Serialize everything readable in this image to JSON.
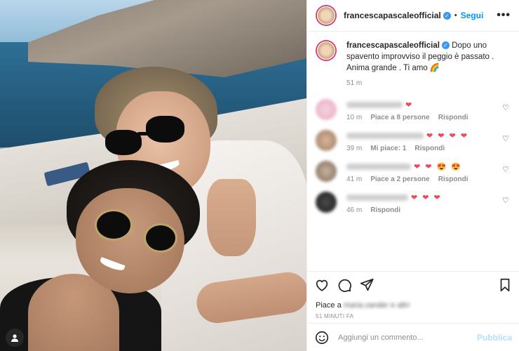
{
  "post": {
    "username": "francescapascaleofficial",
    "follow_label": "Segui",
    "more_label": "•••",
    "caption": "Dopo uno spavento improvviso il peggio è passato . Anima grande . Ti amo 🌈",
    "caption_time": "51 m"
  },
  "comments": [
    {
      "hearts": "❤",
      "time": "10 m",
      "likes": "Piace a 8 persone",
      "reply": "Rispondi"
    },
    {
      "hearts": "❤ ❤ ❤ ❤",
      "time": "39 m",
      "likes": "Mi piace: 1",
      "reply": "Rispondi"
    },
    {
      "hearts": "❤ ❤ 😍 😍",
      "time": "41 m",
      "likes": "Piace a 2 persone",
      "reply": "Rispondi"
    },
    {
      "hearts": "❤ ❤ ❤",
      "time": "46 m",
      "likes": "Rispondi",
      "reply": ""
    }
  ],
  "likes_text": "Piace a",
  "likes_blurred": "maria.vander e altri",
  "post_time": "51 MINUTI FA",
  "add_comment": {
    "placeholder": "Aggiungi un commento...",
    "publish_label": "Pubblica"
  },
  "icons": {
    "like": "heart-icon",
    "comment": "comment-icon",
    "share": "send-icon",
    "save": "bookmark-icon",
    "emoji": "emoji-icon",
    "tag": "user-tag-icon"
  },
  "colors": {
    "accent": "#0095f6",
    "verified": "#3897f0",
    "publish_disabled": "#b2dffc"
  }
}
